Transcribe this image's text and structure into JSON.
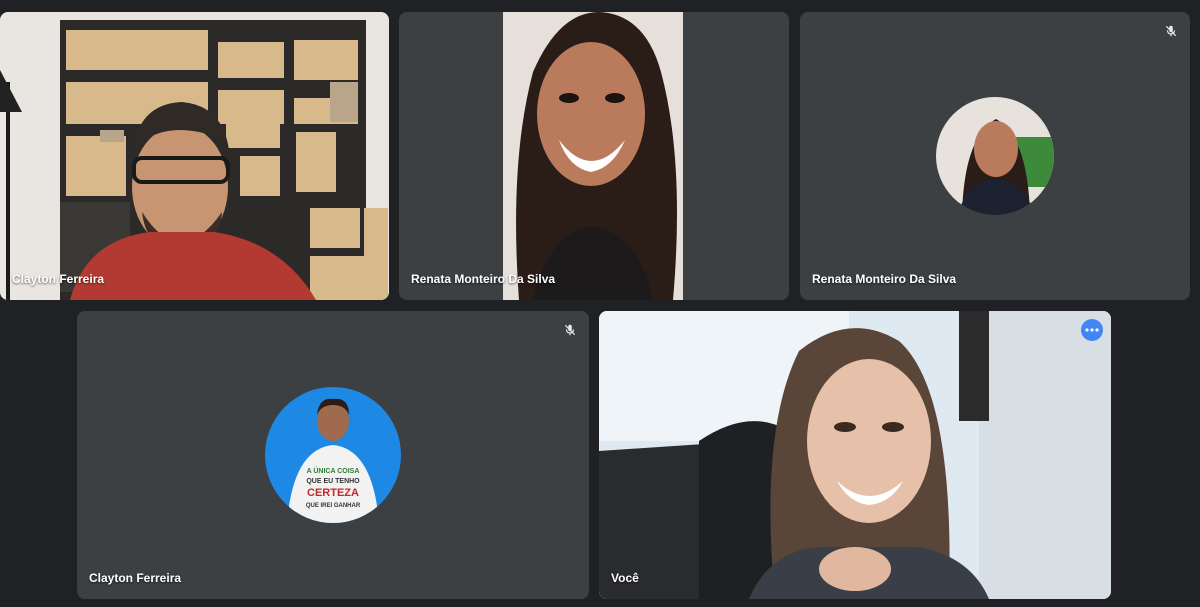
{
  "participants": [
    {
      "name": "Clayton Ferreira",
      "mode": "video"
    },
    {
      "name": "Renata Monteiro Da Silva",
      "mode": "video"
    },
    {
      "name": "Renata Monteiro Da Silva",
      "mode": "avatar",
      "muted": true
    },
    {
      "name": "Clayton Ferreira",
      "mode": "avatar",
      "muted": true
    },
    {
      "name": "Você",
      "mode": "video",
      "self": true
    }
  ],
  "tshirt_print": [
    "A ÚNICA COISA",
    "QUE EU TENHO",
    "CERTEZA",
    "QUE IREI GANHAR"
  ],
  "colors": {
    "background": "#202124",
    "tile": "#3c4043",
    "active_border": "#8ab4f8",
    "menu_button": "#4285f4"
  },
  "icons": {
    "mic_off": "mic-off-icon",
    "more": "more-options-icon"
  }
}
